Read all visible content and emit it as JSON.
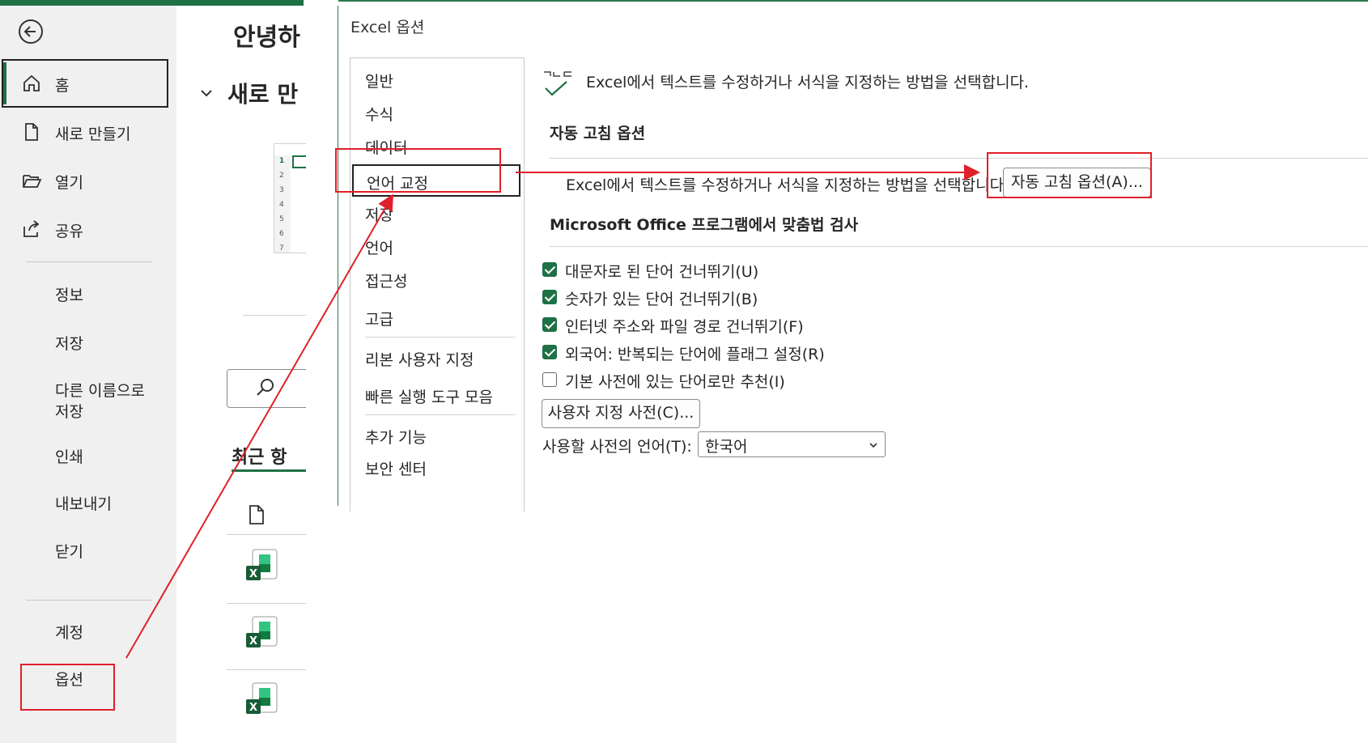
{
  "backstage": {
    "nav": {
      "home": "홈",
      "new": "새로 만들기",
      "open": "열기",
      "share": "공유",
      "info": "정보",
      "save": "저장",
      "save_as_line1": "다른 이름으로",
      "save_as_line2": "저장",
      "print": "인쇄",
      "export": "내보내기",
      "close": "닫기",
      "account": "계정",
      "options": "옵션"
    },
    "content": {
      "greeting": "안녕하",
      "new_section": "새로 만",
      "recent_label": "최근 항",
      "row_numbers": [
        "1",
        "2",
        "3",
        "4",
        "5",
        "6",
        "7"
      ]
    }
  },
  "dialog": {
    "title": "Excel 옵션",
    "categories": [
      "일반",
      "수식",
      "데이터",
      "언어 교정",
      "저장",
      "언어",
      "접근성",
      "고급",
      "리본 사용자 지정",
      "빠른 실행 도구 모음",
      "추가 기능",
      "보안 센터"
    ],
    "selected_category": "언어 교정",
    "header_text": "Excel에서 텍스트를 수정하거나 서식을 지정하는 방법을 선택합니다.",
    "autocorrect_section": {
      "title": "자동 고침 옵션",
      "description": "Excel에서 텍스트를 수정하거나 서식을 지정하는 방법을 선택합니다.",
      "button": "자동 고침 옵션(A)..."
    },
    "spelling_section": {
      "title": "Microsoft Office 프로그램에서 맞춤법 검사",
      "options": [
        {
          "label": "대문자로 된 단어 건너뛰기(U)",
          "checked": true
        },
        {
          "label": "숫자가 있는 단어 건너뛰기(B)",
          "checked": true
        },
        {
          "label": "인터넷 주소와 파일 경로 건너뛰기(F)",
          "checked": true
        },
        {
          "label": "외국어: 반복되는 단어에 플래그 설정(R)",
          "checked": true
        },
        {
          "label": "기본 사전에 있는 단어로만 추천(I)",
          "checked": false
        }
      ],
      "custom_dict_button": "사용자 지정 사전(C)...",
      "dict_language_label": "사용할 사전의 언어(T):",
      "dict_language_value": "한국어"
    }
  },
  "colors": {
    "accent": "#1e7145",
    "highlight": "#e0202a"
  }
}
